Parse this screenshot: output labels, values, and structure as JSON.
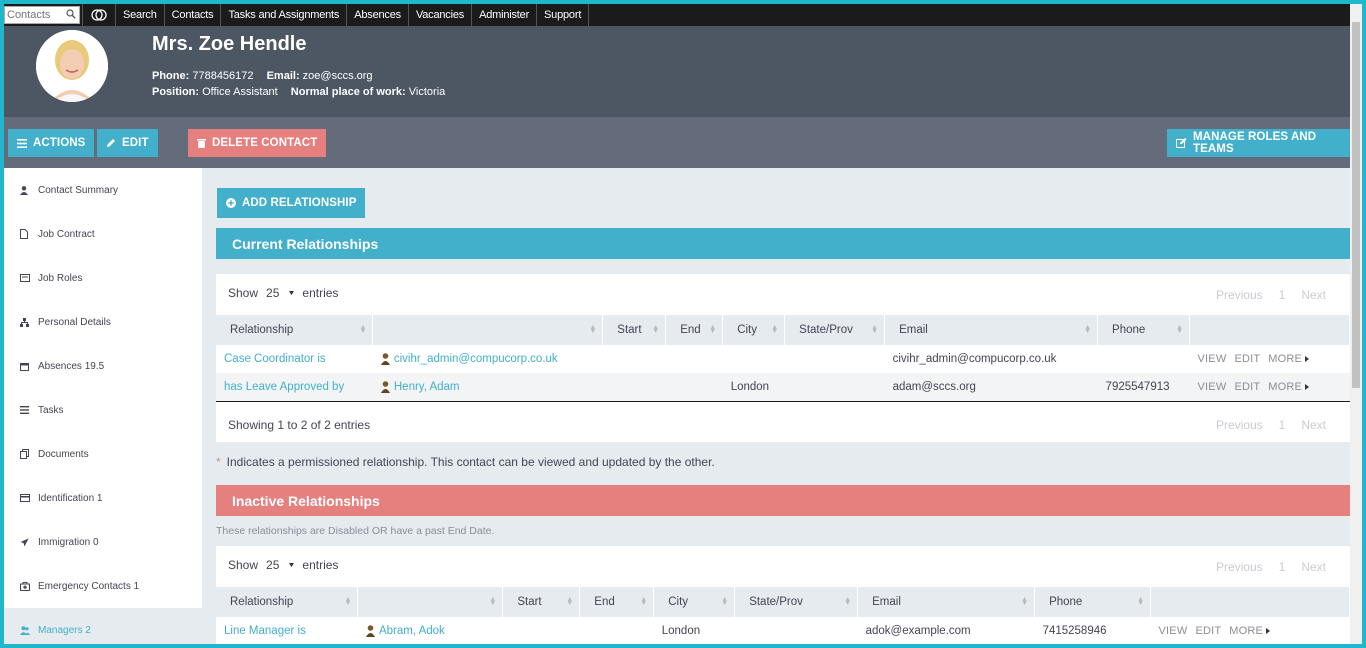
{
  "topbar": {
    "search_placeholder": "Contacts",
    "menu": [
      "Search",
      "Contacts",
      "Tasks and Assignments",
      "Absences",
      "Vacancies",
      "Administer",
      "Support"
    ]
  },
  "contact": {
    "name": "Mrs. Zoe Hendle",
    "phone_label": "Phone:",
    "phone": "7788456172",
    "email_label": "Email:",
    "email": "zoe@sccs.org",
    "position_label": "Position:",
    "position": "Office Assistant",
    "work_label": "Normal place of work:",
    "work": "Victoria"
  },
  "actions": {
    "actions_label": "ACTIONS",
    "edit_label": "EDIT",
    "delete_label": "DELETE CONTACT",
    "roles_label": "MANAGE ROLES AND TEAMS"
  },
  "sidebar": {
    "items": [
      {
        "label": "Contact Summary",
        "icon": "user-icon"
      },
      {
        "label": "Job Contract",
        "icon": "file-icon"
      },
      {
        "label": "Job Roles",
        "icon": "card-icon"
      },
      {
        "label": "Personal Details",
        "icon": "sitemap-icon"
      },
      {
        "label": "Absences 19.5",
        "icon": "calendar-icon"
      },
      {
        "label": "Tasks",
        "icon": "list-icon"
      },
      {
        "label": "Documents",
        "icon": "documents-icon"
      },
      {
        "label": "Identification 1",
        "icon": "id-card-icon"
      },
      {
        "label": "Immigration 0",
        "icon": "plane-icon"
      },
      {
        "label": "Emergency Contacts 1",
        "icon": "medkit-icon"
      },
      {
        "label": "Managers 2",
        "icon": "users-icon"
      }
    ]
  },
  "main": {
    "add_relationship": "ADD RELATIONSHIP",
    "current_title": "Current Relationships",
    "inactive_title": "Inactive Relationships",
    "inactive_note": "These relationships are Disabled OR have a past End Date.",
    "perm_note": "Indicates a permissioned relationship. This contact can be viewed and updated by the other.",
    "star": "*",
    "show": "Show",
    "entries": "entries",
    "page_size": "25",
    "prev": "Previous",
    "page": "1",
    "next": "Next",
    "showing": "Showing 1 to 2 of 2 entries",
    "columns": [
      "Relationship",
      "",
      "Start",
      "End",
      "City",
      "State/Prov",
      "Email",
      "Phone",
      ""
    ],
    "row_actions": [
      "VIEW",
      "EDIT",
      "MORE"
    ],
    "current_rows": [
      {
        "relationship": "Case Coordinator is",
        "contact": "civihr_admin@compucorp.co.uk",
        "start": "",
        "end": "",
        "city": "",
        "state": "",
        "email": "civihr_admin@compucorp.co.uk",
        "phone": ""
      },
      {
        "relationship": "has Leave Approved by",
        "contact": "Henry, Adam",
        "start": "",
        "end": "",
        "city": "London",
        "state": "",
        "email": "adam@sccs.org",
        "phone": "7925547913"
      }
    ],
    "inactive_rows": [
      {
        "relationship": "Line Manager is",
        "contact": "Abram, Adok",
        "start": "",
        "end": "",
        "city": "London",
        "state": "",
        "email": "adok@example.com",
        "phone": "7415258946"
      }
    ]
  }
}
